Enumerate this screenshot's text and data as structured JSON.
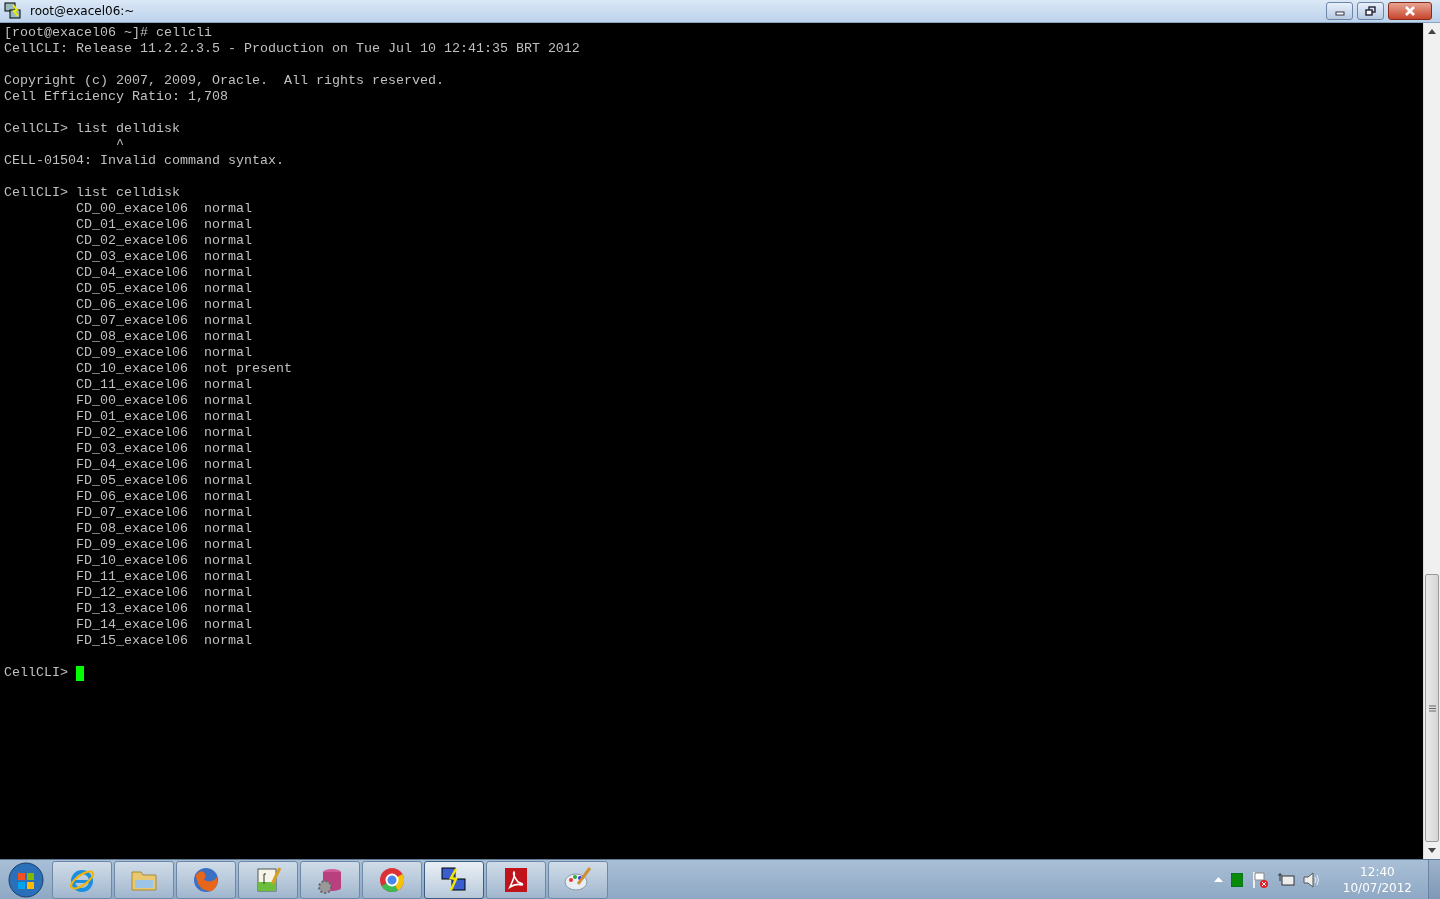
{
  "window": {
    "title": "root@exacel06:~"
  },
  "terminal": {
    "lines": [
      {
        "kind": "text",
        "text": "[root@exacel06 ~]# cellcli"
      },
      {
        "kind": "text",
        "text": "CellCLI: Release 11.2.2.3.5 - Production on Tue Jul 10 12:41:35 BRT 2012"
      },
      {
        "kind": "blank"
      },
      {
        "kind": "text",
        "text": "Copyright (c) 2007, 2009, Oracle.  All rights reserved."
      },
      {
        "kind": "text",
        "text": "Cell Efficiency Ratio: 1,708"
      },
      {
        "kind": "blank"
      },
      {
        "kind": "text",
        "text": "CellCLI> list delldisk"
      },
      {
        "kind": "text",
        "text": "              ^"
      },
      {
        "kind": "text",
        "text": "CELL-01504: Invalid command syntax."
      },
      {
        "kind": "blank"
      },
      {
        "kind": "text",
        "text": "CellCLI> list celldisk"
      },
      {
        "kind": "text",
        "text": "         CD_00_exacel06  normal"
      },
      {
        "kind": "text",
        "text": "         CD_01_exacel06  normal"
      },
      {
        "kind": "text",
        "text": "         CD_02_exacel06  normal"
      },
      {
        "kind": "text",
        "text": "         CD_03_exacel06  normal"
      },
      {
        "kind": "text",
        "text": "         CD_04_exacel06  normal"
      },
      {
        "kind": "text",
        "text": "         CD_05_exacel06  normal"
      },
      {
        "kind": "text",
        "text": "         CD_06_exacel06  normal"
      },
      {
        "kind": "text",
        "text": "         CD_07_exacel06  normal"
      },
      {
        "kind": "text",
        "text": "         CD_08_exacel06  normal"
      },
      {
        "kind": "text",
        "text": "         CD_09_exacel06  normal"
      },
      {
        "kind": "text",
        "text": "         CD_10_exacel06  not present"
      },
      {
        "kind": "text",
        "text": "         CD_11_exacel06  normal"
      },
      {
        "kind": "text",
        "text": "         FD_00_exacel06  normal"
      },
      {
        "kind": "text",
        "text": "         FD_01_exacel06  normal"
      },
      {
        "kind": "text",
        "text": "         FD_02_exacel06  normal"
      },
      {
        "kind": "text",
        "text": "         FD_03_exacel06  normal"
      },
      {
        "kind": "text",
        "text": "         FD_04_exacel06  normal"
      },
      {
        "kind": "text",
        "text": "         FD_05_exacel06  normal"
      },
      {
        "kind": "text",
        "text": "         FD_06_exacel06  normal"
      },
      {
        "kind": "text",
        "text": "         FD_07_exacel06  normal"
      },
      {
        "kind": "text",
        "text": "         FD_08_exacel06  normal"
      },
      {
        "kind": "text",
        "text": "         FD_09_exacel06  normal"
      },
      {
        "kind": "text",
        "text": "         FD_10_exacel06  normal"
      },
      {
        "kind": "text",
        "text": "         FD_11_exacel06  normal"
      },
      {
        "kind": "text",
        "text": "         FD_12_exacel06  normal"
      },
      {
        "kind": "text",
        "text": "         FD_13_exacel06  normal"
      },
      {
        "kind": "text",
        "text": "         FD_14_exacel06  normal"
      },
      {
        "kind": "text",
        "text": "         FD_15_exacel06  normal"
      },
      {
        "kind": "blank"
      },
      {
        "kind": "prompt",
        "text": "CellCLI>"
      }
    ]
  },
  "taskbar": {
    "buttons": [
      {
        "kind": "ie",
        "selected": false
      },
      {
        "kind": "folder",
        "selected": false
      },
      {
        "kind": "firefox",
        "selected": false
      },
      {
        "kind": "notepad",
        "selected": false
      },
      {
        "kind": "database",
        "selected": false
      },
      {
        "kind": "chrome",
        "selected": false
      },
      {
        "kind": "putty",
        "selected": true
      },
      {
        "kind": "pdf",
        "selected": false
      },
      {
        "kind": "paint",
        "selected": false
      }
    ]
  },
  "clock": {
    "time": "12:40",
    "date": "10/07/2012"
  }
}
